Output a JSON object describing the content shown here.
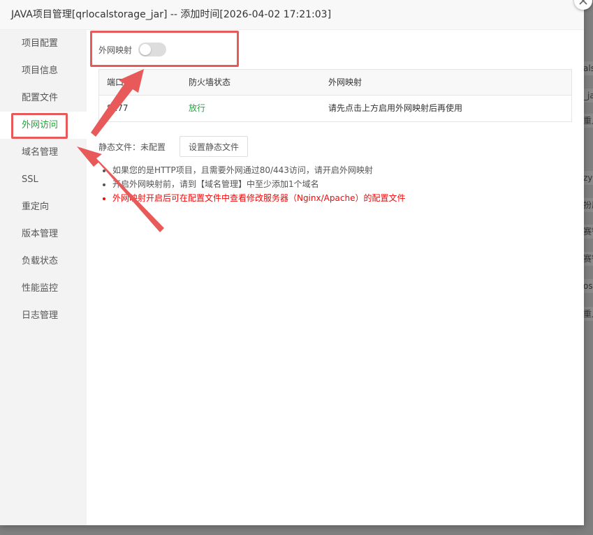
{
  "window": {
    "title": "JAVA项目管理[qrlocalstorage_jar] -- 添加时间[2026-04-02 17:21:03]"
  },
  "sidebar": {
    "items": [
      {
        "label": "项目配置",
        "active": false
      },
      {
        "label": "项目信息",
        "active": false
      },
      {
        "label": "配置文件",
        "active": false
      },
      {
        "label": "外网访问",
        "active": true
      },
      {
        "label": "域名管理",
        "active": false
      },
      {
        "label": "SSL",
        "active": false
      },
      {
        "label": "重定向",
        "active": false
      },
      {
        "label": "版本管理",
        "active": false
      },
      {
        "label": "负载状态",
        "active": false
      },
      {
        "label": "性能监控",
        "active": false
      },
      {
        "label": "日志管理",
        "active": false
      }
    ]
  },
  "main": {
    "mapping_toggle": {
      "label": "外网映射",
      "enabled": false
    },
    "table": {
      "headers": [
        "端口",
        "防火墙状态",
        "外网映射"
      ],
      "rows": [
        {
          "port": "8177",
          "firewall": "放行",
          "mapping": "请先点击上方启用外网映射后再使用"
        }
      ]
    },
    "static_file": {
      "label": "静态文件：未配置",
      "button_label": "设置静态文件"
    },
    "notes": [
      {
        "text": "如果您的是HTTP项目，且需要外网通过80/443访问，请开启外网映射",
        "warning": false
      },
      {
        "text": "开启外网映射前，请到【域名管理】中至少添加1个域名",
        "warning": false
      },
      {
        "text": "外网映射开启后可在配置文件中查看修改服务器（Nginx/Apache）的配置文件",
        "warning": true
      }
    ]
  },
  "background": {
    "fragments": [
      "als",
      "_ja",
      "重点",
      "zyh",
      "扮原",
      "赛智",
      "赛智",
      "osl",
      "重点"
    ]
  },
  "colors": {
    "accent": "#20a53a",
    "warning": "#ef0808",
    "annotation": "#e85a5a",
    "sidebar_bg": "#f3f3f3"
  }
}
